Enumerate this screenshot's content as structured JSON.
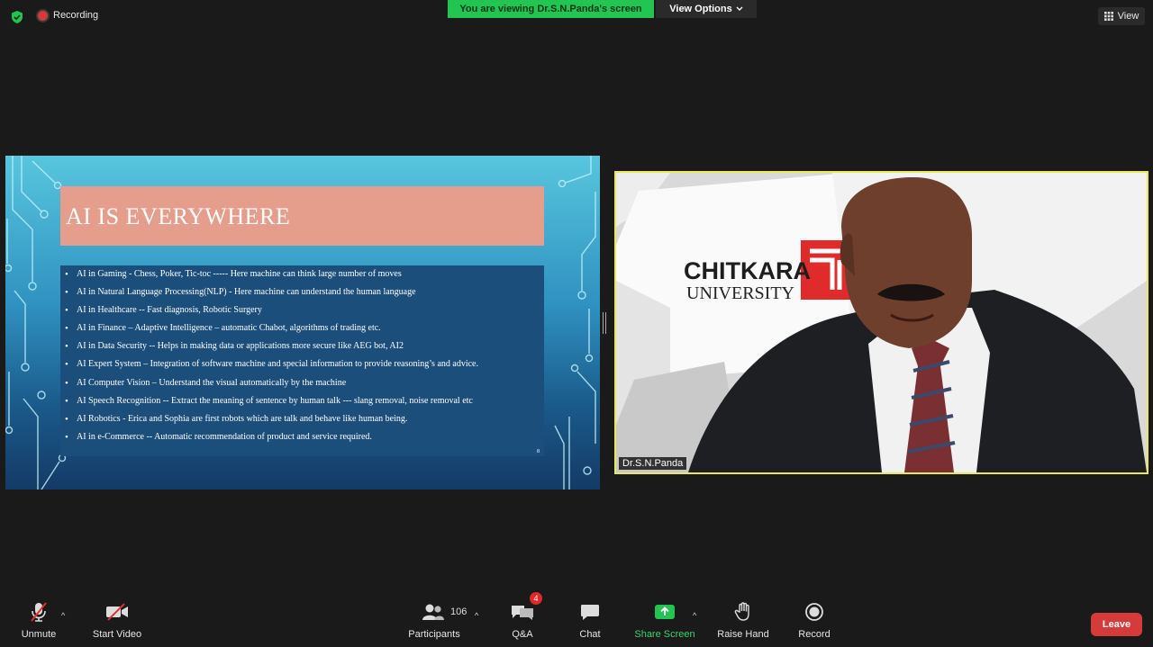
{
  "top": {
    "recording_label": "Recording",
    "viewing_banner": "You are viewing Dr.S.N.Panda's screen",
    "view_options": "View Options",
    "view_label": "View"
  },
  "slide": {
    "title": "AI IS EVERYWHERE",
    "page_number": "8",
    "bullets": [
      "AI in Gaming  -  Chess, Poker, Tic-toc ----- Here machine can think large number of moves",
      "AI in Natural Language Processing(NLP) -  Here machine can understand the human language",
      "AI in Healthcare  --  Fast diagnosis, Robotic Surgery",
      "AI in Finance – Adaptive Intelligence – automatic Chabot, algorithms of trading etc.",
      "AI in Data Security  --  Helps in making data or applications more secure  like AEG bot, AI2",
      "AI Expert System – Integration of software machine and special information to provide reasoning’s and advice.",
      "AI Computer Vision – Understand the visual automatically by the machine",
      "AI Speech Recognition --  Extract the meaning of sentence by human talk --- slang removal, noise removal etc",
      "AI Robotics  -  Erica  and Sophia   are first robots which are talk and behave like human being.",
      "AI in e-Commerce --   Automatic recommendation of product and service required."
    ]
  },
  "video": {
    "participant_name": "Dr.S.N.Panda",
    "logo_line1": "CHITKARA",
    "logo_line2": "UNIVERSITY"
  },
  "toolbar": {
    "unmute": "Unmute",
    "start_video": "Start Video",
    "participants": "Participants",
    "participants_count": "106",
    "qa": "Q&A",
    "qa_badge": "4",
    "chat": "Chat",
    "share_screen": "Share Screen",
    "raise_hand": "Raise Hand",
    "record": "Record",
    "leave": "Leave"
  },
  "colors": {
    "banner_green": "#23c552",
    "leave_red": "#d63b3b",
    "active_speaker_border": "#e6e95a"
  }
}
